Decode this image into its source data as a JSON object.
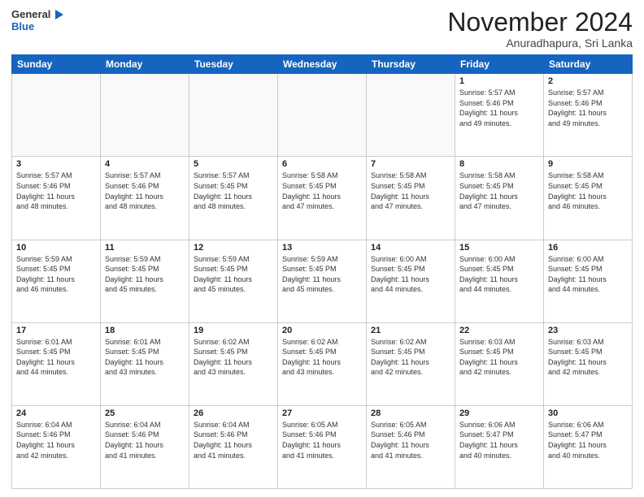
{
  "header": {
    "logo_line1": "General",
    "logo_line2": "Blue",
    "month": "November 2024",
    "location": "Anuradhapura, Sri Lanka"
  },
  "weekdays": [
    "Sunday",
    "Monday",
    "Tuesday",
    "Wednesday",
    "Thursday",
    "Friday",
    "Saturday"
  ],
  "weeks": [
    [
      {
        "day": "",
        "info": "",
        "empty": true
      },
      {
        "day": "",
        "info": "",
        "empty": true
      },
      {
        "day": "",
        "info": "",
        "empty": true
      },
      {
        "day": "",
        "info": "",
        "empty": true
      },
      {
        "day": "",
        "info": "",
        "empty": true
      },
      {
        "day": "1",
        "info": "Sunrise: 5:57 AM\nSunset: 5:46 PM\nDaylight: 11 hours\nand 49 minutes."
      },
      {
        "day": "2",
        "info": "Sunrise: 5:57 AM\nSunset: 5:46 PM\nDaylight: 11 hours\nand 49 minutes."
      }
    ],
    [
      {
        "day": "3",
        "info": "Sunrise: 5:57 AM\nSunset: 5:46 PM\nDaylight: 11 hours\nand 48 minutes."
      },
      {
        "day": "4",
        "info": "Sunrise: 5:57 AM\nSunset: 5:46 PM\nDaylight: 11 hours\nand 48 minutes."
      },
      {
        "day": "5",
        "info": "Sunrise: 5:57 AM\nSunset: 5:45 PM\nDaylight: 11 hours\nand 48 minutes."
      },
      {
        "day": "6",
        "info": "Sunrise: 5:58 AM\nSunset: 5:45 PM\nDaylight: 11 hours\nand 47 minutes."
      },
      {
        "day": "7",
        "info": "Sunrise: 5:58 AM\nSunset: 5:45 PM\nDaylight: 11 hours\nand 47 minutes."
      },
      {
        "day": "8",
        "info": "Sunrise: 5:58 AM\nSunset: 5:45 PM\nDaylight: 11 hours\nand 47 minutes."
      },
      {
        "day": "9",
        "info": "Sunrise: 5:58 AM\nSunset: 5:45 PM\nDaylight: 11 hours\nand 46 minutes."
      }
    ],
    [
      {
        "day": "10",
        "info": "Sunrise: 5:59 AM\nSunset: 5:45 PM\nDaylight: 11 hours\nand 46 minutes."
      },
      {
        "day": "11",
        "info": "Sunrise: 5:59 AM\nSunset: 5:45 PM\nDaylight: 11 hours\nand 45 minutes."
      },
      {
        "day": "12",
        "info": "Sunrise: 5:59 AM\nSunset: 5:45 PM\nDaylight: 11 hours\nand 45 minutes."
      },
      {
        "day": "13",
        "info": "Sunrise: 5:59 AM\nSunset: 5:45 PM\nDaylight: 11 hours\nand 45 minutes."
      },
      {
        "day": "14",
        "info": "Sunrise: 6:00 AM\nSunset: 5:45 PM\nDaylight: 11 hours\nand 44 minutes."
      },
      {
        "day": "15",
        "info": "Sunrise: 6:00 AM\nSunset: 5:45 PM\nDaylight: 11 hours\nand 44 minutes."
      },
      {
        "day": "16",
        "info": "Sunrise: 6:00 AM\nSunset: 5:45 PM\nDaylight: 11 hours\nand 44 minutes."
      }
    ],
    [
      {
        "day": "17",
        "info": "Sunrise: 6:01 AM\nSunset: 5:45 PM\nDaylight: 11 hours\nand 44 minutes."
      },
      {
        "day": "18",
        "info": "Sunrise: 6:01 AM\nSunset: 5:45 PM\nDaylight: 11 hours\nand 43 minutes."
      },
      {
        "day": "19",
        "info": "Sunrise: 6:02 AM\nSunset: 5:45 PM\nDaylight: 11 hours\nand 43 minutes."
      },
      {
        "day": "20",
        "info": "Sunrise: 6:02 AM\nSunset: 5:45 PM\nDaylight: 11 hours\nand 43 minutes."
      },
      {
        "day": "21",
        "info": "Sunrise: 6:02 AM\nSunset: 5:45 PM\nDaylight: 11 hours\nand 42 minutes."
      },
      {
        "day": "22",
        "info": "Sunrise: 6:03 AM\nSunset: 5:45 PM\nDaylight: 11 hours\nand 42 minutes."
      },
      {
        "day": "23",
        "info": "Sunrise: 6:03 AM\nSunset: 5:45 PM\nDaylight: 11 hours\nand 42 minutes."
      }
    ],
    [
      {
        "day": "24",
        "info": "Sunrise: 6:04 AM\nSunset: 5:46 PM\nDaylight: 11 hours\nand 42 minutes."
      },
      {
        "day": "25",
        "info": "Sunrise: 6:04 AM\nSunset: 5:46 PM\nDaylight: 11 hours\nand 41 minutes."
      },
      {
        "day": "26",
        "info": "Sunrise: 6:04 AM\nSunset: 5:46 PM\nDaylight: 11 hours\nand 41 minutes."
      },
      {
        "day": "27",
        "info": "Sunrise: 6:05 AM\nSunset: 5:46 PM\nDaylight: 11 hours\nand 41 minutes."
      },
      {
        "day": "28",
        "info": "Sunrise: 6:05 AM\nSunset: 5:46 PM\nDaylight: 11 hours\nand 41 minutes."
      },
      {
        "day": "29",
        "info": "Sunrise: 6:06 AM\nSunset: 5:47 PM\nDaylight: 11 hours\nand 40 minutes."
      },
      {
        "day": "30",
        "info": "Sunrise: 6:06 AM\nSunset: 5:47 PM\nDaylight: 11 hours\nand 40 minutes."
      }
    ]
  ]
}
